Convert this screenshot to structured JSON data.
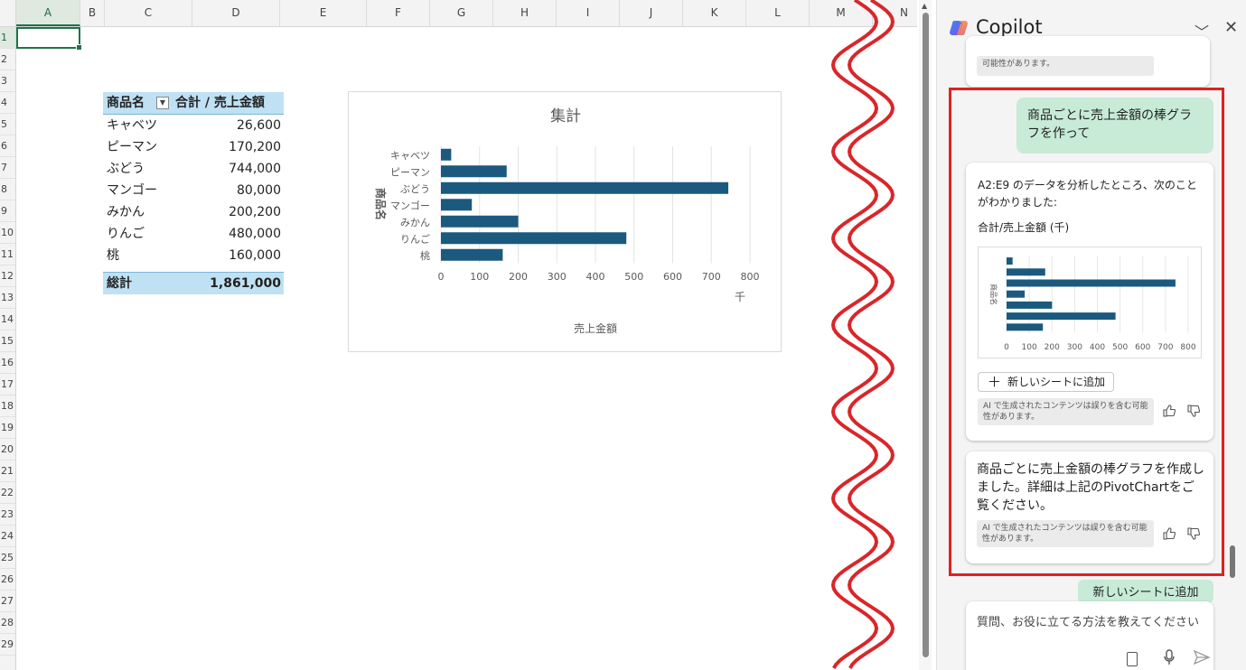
{
  "sheet": {
    "columns": [
      "A",
      "B",
      "C",
      "D",
      "E",
      "F",
      "G",
      "H",
      "I",
      "J",
      "K",
      "L",
      "M",
      "N"
    ],
    "rows": [
      "1",
      "2",
      "3",
      "4",
      "5",
      "6",
      "7",
      "8",
      "9",
      "10",
      "11",
      "12",
      "13",
      "14",
      "15",
      "16",
      "17",
      "18",
      "19",
      "20",
      "21",
      "22",
      "23",
      "24",
      "25",
      "26",
      "27",
      "28",
      "29"
    ],
    "selected_cell": "A1"
  },
  "pivot": {
    "header_label": "商品名",
    "header_value": "合計 / 売上金額",
    "rows": [
      {
        "label": "キャベツ",
        "value": "26,600"
      },
      {
        "label": "ピーマン",
        "value": "170,200"
      },
      {
        "label": "ぶどう",
        "value": "744,000"
      },
      {
        "label": "マンゴー",
        "value": "80,000"
      },
      {
        "label": "みかん",
        "value": "200,200"
      },
      {
        "label": "りんご",
        "value": "480,000"
      },
      {
        "label": "桃",
        "value": "160,000"
      }
    ],
    "total_label": "総計",
    "total_value": "1,861,000"
  },
  "chart_data": [
    {
      "type": "bar",
      "orientation": "horizontal",
      "title": "集計",
      "xlabel": "売上金額",
      "ylabel": "商品名",
      "unit_label": "千",
      "categories": [
        "キャベツ",
        "ピーマン",
        "ぶどう",
        "マンゴー",
        "みかん",
        "りんご",
        "桃"
      ],
      "values": [
        26.6,
        170.2,
        744,
        80,
        200.2,
        480,
        160
      ],
      "xticks": [
        0,
        100,
        200,
        300,
        400,
        500,
        600,
        700,
        800
      ],
      "xlim": [
        0,
        800
      ],
      "grid": true,
      "bar_color": "#1b5a7e"
    },
    {
      "type": "bar",
      "orientation": "horizontal",
      "title": "",
      "ylabel": "商品名",
      "values": [
        26.6,
        170.2,
        744,
        80,
        200.2,
        480,
        160
      ],
      "xticks": [
        0,
        100,
        200,
        300,
        400,
        500,
        600,
        700,
        800
      ],
      "xlim": [
        0,
        800
      ],
      "grid": true,
      "bar_color": "#1b5a7e"
    }
  ],
  "copilot": {
    "title": "Copilot",
    "prev_disclaimer": "可能性があります。",
    "user_message": "商品ごとに売上金額の棒グラフを作って",
    "analysis_text": "A2:E9 のデータを分析したところ、次のことがわかりました:",
    "analysis_subtitle": "合計/売上金額 (千)",
    "add_sheet_label": "新しいシートに追加",
    "disclaimer": "AI で生成されたコンテンツは誤りを含む可能性があります。",
    "done_message": "商品ごとに売上金額の棒グラフを作成しました。詳細は上記のPivotChartをご覧ください。",
    "suggestion_chip": "新しいシートに追加",
    "input_placeholder": "質問、お役に立てる方法を教えてください"
  },
  "colors": {
    "accent_green": "#217346",
    "header_blue": "#bfe1f3",
    "bar": "#1b5a7e",
    "bubble": "#c7ebd7",
    "highlight": "#e02020",
    "tear": "#d9262a"
  }
}
